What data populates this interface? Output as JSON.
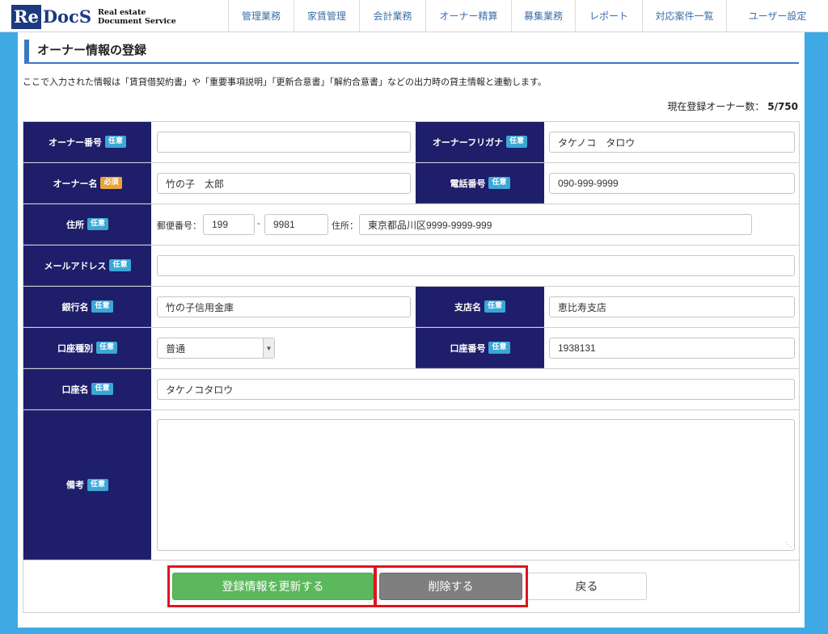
{
  "header": {
    "logo_re": "Re",
    "logo_docs": "DocS",
    "logo_sub1": "Real estate",
    "logo_sub2": "Document Service",
    "nav": [
      "管理業務",
      "家賃管理",
      "会計業務",
      "オーナー精算",
      "募集業務",
      "レポート",
      "対応案件一覧",
      "ユーザー設定"
    ]
  },
  "page": {
    "title": "オーナー情報の登録",
    "description": "ここで入力された情報は「賃貸借契約書」や「重要事項説明」「更新合意書」「解約合意書」などの出力時の貸主情報と連動します。",
    "count_label": "現在登録オーナー数：",
    "count_value": "5/750"
  },
  "badges": {
    "optional": "任意",
    "required": "必須"
  },
  "fields": {
    "owner_number": {
      "label": "オーナー番号",
      "value": ""
    },
    "owner_kana": {
      "label": "オーナーフリガナ",
      "value": "タケノコ　タロウ"
    },
    "owner_name": {
      "label": "オーナー名",
      "value": "竹の子　太郎"
    },
    "phone": {
      "label": "電話番号",
      "value": "090-999-9999"
    },
    "address": {
      "label": "住所",
      "postal_label": "郵便番号：",
      "postal1": "199",
      "sep": "-",
      "postal2": "9981",
      "addr_label": "住所：",
      "addr_value": "東京都品川区9999-9999-999"
    },
    "email": {
      "label": "メールアドレス",
      "value": ""
    },
    "bank": {
      "label": "銀行名",
      "value": "竹の子信用金庫"
    },
    "branch": {
      "label": "支店名",
      "value": "恵比寿支店"
    },
    "account_type": {
      "label": "口座種別",
      "value": "普通"
    },
    "account_number": {
      "label": "口座番号",
      "value": "1938131"
    },
    "account_name": {
      "label": "口座名",
      "value": "タケノコタロウ"
    },
    "remarks": {
      "label": "備考",
      "value": ""
    }
  },
  "buttons": {
    "update": "登録情報を更新する",
    "delete": "削除する",
    "back": "戻る"
  },
  "colors": {
    "background": "#3fa9e6",
    "label_bg": "#1e1e6a",
    "optional_badge": "#3ba7d6",
    "required_badge": "#e8a33a",
    "update_button": "#5cb85c",
    "delete_button": "#7f7f7f",
    "highlight": "#e0141e"
  }
}
